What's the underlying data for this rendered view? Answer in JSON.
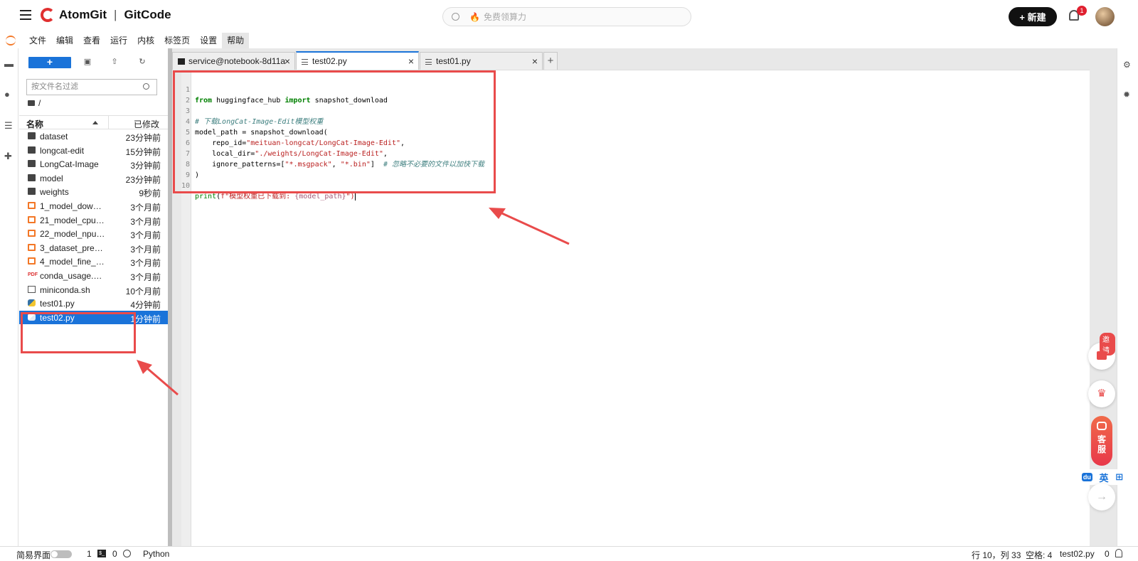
{
  "topbar": {
    "brand_left": "AtomGit",
    "brand_sep": "|",
    "brand_right": "GitCode",
    "search_placeholder": "免费领算力",
    "new_button": "+ 新建",
    "notification_count": "1"
  },
  "menu": {
    "items": [
      "文件",
      "编辑",
      "查看",
      "运行",
      "内核",
      "标签页",
      "设置",
      "帮助"
    ]
  },
  "filepanel": {
    "new_button": "+",
    "filter_placeholder": "按文件名过滤",
    "breadcrumb": "/",
    "col_name": "名称",
    "col_modified": "已修改",
    "files": [
      {
        "name": "dataset",
        "time": "23分钟前",
        "type": "folder"
      },
      {
        "name": "longcat-edit",
        "time": "15分钟前",
        "type": "folder"
      },
      {
        "name": "LongCat-Image",
        "time": "3分钟前",
        "type": "folder"
      },
      {
        "name": "model",
        "time": "23分钟前",
        "type": "folder"
      },
      {
        "name": "weights",
        "time": "9秒前",
        "type": "folder"
      },
      {
        "name": "1_model_downl...",
        "time": "3个月前",
        "type": "notebook"
      },
      {
        "name": "21_model_cpu_i...",
        "time": "3个月前",
        "type": "notebook"
      },
      {
        "name": "22_model_npu_i...",
        "time": "3个月前",
        "type": "notebook"
      },
      {
        "name": "3_dataset_prepa...",
        "time": "3个月前",
        "type": "notebook"
      },
      {
        "name": "4_model_fine_tu...",
        "time": "3个月前",
        "type": "notebook"
      },
      {
        "name": "conda_usage.pdf",
        "time": "3个月前",
        "type": "pdf"
      },
      {
        "name": "miniconda.sh",
        "time": "10个月前",
        "type": "shell"
      },
      {
        "name": "test01.py",
        "time": "4分钟前",
        "type": "python"
      },
      {
        "name": "test02.py",
        "time": "1分钟前",
        "type": "python",
        "selected": true
      }
    ]
  },
  "tabs": [
    {
      "label": "service@notebook-8d11a",
      "icon": "terminal"
    },
    {
      "label": "test02.py",
      "icon": "document",
      "active": true
    },
    {
      "label": "test01.py",
      "icon": "document"
    }
  ],
  "tab_add": "+",
  "editor": {
    "lines": [
      {
        "n": "1"
      },
      {
        "n": "2"
      },
      {
        "n": "3"
      },
      {
        "n": "4"
      },
      {
        "n": "5"
      },
      {
        "n": "6"
      },
      {
        "n": "7"
      },
      {
        "n": "8"
      },
      {
        "n": "9"
      },
      {
        "n": "10"
      }
    ],
    "code": {
      "l1_from": "from",
      "l1_mod": " huggingface_hub ",
      "l1_import": "import",
      "l1_name": " snapshot_download",
      "l3": "# 下载LongCat-Image-Edit模型权重",
      "l4": "model_path = snapshot_download(",
      "l5_a": "    repo_id=",
      "l5_s": "\"meituan-longcat/LongCat-Image-Edit\"",
      "l5_b": ",",
      "l6_a": "    local_dir=",
      "l6_s": "\"./weights/LongCat-Image-Edit\"",
      "l6_b": ",",
      "l7_a": "    ignore_patterns=[",
      "l7_s1": "\"*.msgpack\"",
      "l7_c": ", ",
      "l7_s2": "\"*.bin\"",
      "l7_b": "]  ",
      "l7_cmt": "# 忽略不必要的文件以加快下载",
      "l8": ")",
      "l10_print": "print",
      "l10_a": "(",
      "l10_s": "f\"模型权重已下载到: ",
      "l10_var": "{model_path}",
      "l10_e": "\")"
    }
  },
  "floating": {
    "invite_badge": "邀请",
    "support_label_1": "客",
    "support_label_2": "服",
    "ime_lang": "英",
    "ime_grid": "⊞",
    "ime_logo": "du"
  },
  "status": {
    "simple_mode": "简易界面",
    "count1": "1",
    "count2": "0",
    "kernel": "Python",
    "position": "行 10，列 33",
    "indent": "空格: 4",
    "filename": "test02.py",
    "notifications": "0"
  }
}
